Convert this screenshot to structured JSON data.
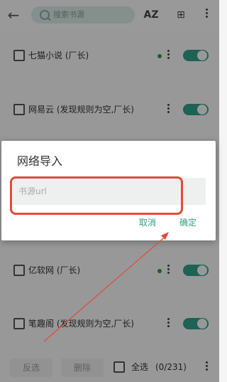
{
  "toolbar": {
    "back_icon": "arrow-left-icon",
    "search_placeholder": "搜索书源",
    "sort_az": "AZ",
    "group_label": "分组",
    "menu_icon": "more-vert-icon"
  },
  "sources": [
    {
      "name": "七猫小说 (厂长)",
      "status_dot": true,
      "enabled": true
    },
    {
      "name": "网易云 (发现规则为空,厂长)",
      "status_dot": false,
      "enabled": true
    },
    {
      "name": "",
      "status_dot": false,
      "enabled": true
    },
    {
      "name": "亿软网 (厂长)",
      "status_dot": true,
      "enabled": true
    },
    {
      "name": "笔趣阁 (发现规则为空,厂长)",
      "status_dot": false,
      "enabled": true
    }
  ],
  "bottom": {
    "invert_label": "反选",
    "delete_label": "删除",
    "select_all_label": "全选",
    "count": "(0/231)"
  },
  "dialog": {
    "title": "网络导入",
    "input_placeholder": "书源url",
    "cancel_label": "取消",
    "ok_label": "确定"
  },
  "colors": {
    "accent": "#2f9e86",
    "status_dot": "#2e9d3f",
    "annotation": "#e14b3c"
  }
}
